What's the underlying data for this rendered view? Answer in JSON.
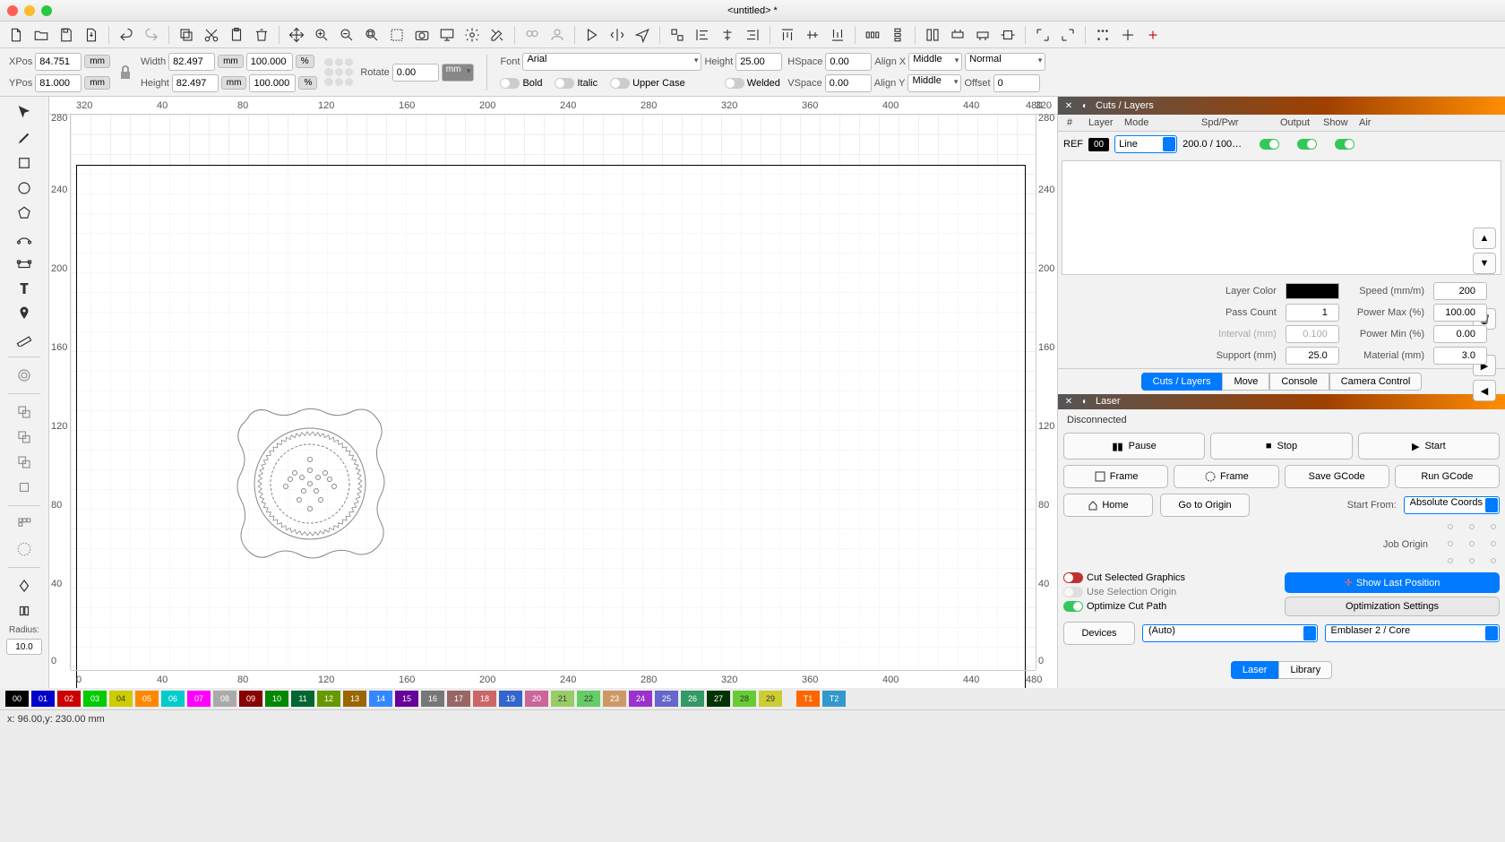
{
  "title": "<untitled> *",
  "props": {
    "xpos_lbl": "XPos",
    "xpos": "84.751",
    "ypos_lbl": "YPos",
    "ypos": "81.000",
    "width_lbl": "Width",
    "width": "82.497",
    "height_lbl": "Height",
    "height": "82.497",
    "w100": "100.000",
    "h100": "100.000",
    "mm": "mm",
    "pct": "%",
    "rotate_lbl": "Rotate",
    "rotate": "0.00",
    "font_lbl": "Font",
    "font": "Arial",
    "fheight_lbl": "Height",
    "fheight": "25.00",
    "hspace_lbl": "HSpace",
    "hspace": "0.00",
    "vspace_lbl": "VSpace",
    "vspace": "0.00",
    "alignx_lbl": "Align X",
    "alignx": "Middle",
    "aligny_lbl": "Align Y",
    "aligny": "Middle",
    "normal": "Normal",
    "offset_lbl": "Offset",
    "offset": "0",
    "bold": "Bold",
    "italic": "Italic",
    "upper": "Upper Case",
    "welded": "Welded"
  },
  "lefttool": {
    "radius_lbl": "Radius:",
    "radius": "10.0"
  },
  "ruler": {
    "t0": "320",
    "t1": "40",
    "t2": "80",
    "t3": "120",
    "t4": "160",
    "t5": "200",
    "t6": "240",
    "t7": "280",
    "t8": "320",
    "t9": "360",
    "t10": "400",
    "t11": "440",
    "t12": "480",
    "t13": "320",
    "b0": "0",
    "v0": "0",
    "v1": "40",
    "v2": "80",
    "v3": "120",
    "v4": "160",
    "v5": "200",
    "v6": "240",
    "v7": "280"
  },
  "cuts": {
    "title": "Cuts / Layers",
    "hdr_hash": "#",
    "hdr_layer": "Layer",
    "hdr_mode": "Mode",
    "hdr_spd": "Spd/Pwr",
    "hdr_out": "Output",
    "hdr_show": "Show",
    "hdr_air": "Air",
    "ref": "REF",
    "layer00": "00",
    "mode": "Line",
    "spdpwr": "200.0 / 100…",
    "lc_lbl": "Layer Color",
    "speed_lbl": "Speed (mm/m)",
    "speed": "200",
    "pass_lbl": "Pass Count",
    "pass": "1",
    "pmax_lbl": "Power Max (%)",
    "pmax": "100.00",
    "int_lbl": "Interval (mm)",
    "int": "0.100",
    "pmin_lbl": "Power Min (%)",
    "pmin": "0.00",
    "sup_lbl": "Support (mm)",
    "sup": "25.0",
    "mat_lbl": "Material (mm)",
    "mat": "3.0",
    "tab_cuts": "Cuts / Layers",
    "tab_move": "Move",
    "tab_console": "Console",
    "tab_cam": "Camera Control"
  },
  "laser": {
    "title": "Laser",
    "status": "Disconnected",
    "pause": "Pause",
    "stop": "Stop",
    "start": "Start",
    "frame1": "Frame",
    "frame2": "Frame",
    "save": "Save GCode",
    "run": "Run GCode",
    "home": "Home",
    "goto": "Go to Origin",
    "startfrom_lbl": "Start From:",
    "startfrom": "Absolute Coords",
    "joborigin": "Job Origin",
    "cutsel": "Cut Selected Graphics",
    "usesel": "Use Selection Origin",
    "opt": "Optimize Cut Path",
    "showlast": "Show Last Position",
    "optset": "Optimization Settings",
    "devices": "Devices",
    "auto": "(Auto)",
    "device": "Emblaser 2 / Core",
    "tab_laser": "Laser",
    "tab_lib": "Library"
  },
  "palette": {
    "c00": "00",
    "c01": "01",
    "c02": "02",
    "c03": "03",
    "c04": "04",
    "c05": "05",
    "c06": "06",
    "c07": "07",
    "c08": "08",
    "c09": "09",
    "c10": "10",
    "c11": "11",
    "c12": "12",
    "c13": "13",
    "c14": "14",
    "c15": "15",
    "c16": "16",
    "c17": "17",
    "c18": "18",
    "c19": "19",
    "c20": "20",
    "c21": "21",
    "c22": "22",
    "c23": "23",
    "c24": "24",
    "c25": "25",
    "c26": "26",
    "c27": "27",
    "c28": "28",
    "c29": "29",
    "t1": "T1",
    "t2": "T2"
  },
  "statusbar": "x: 96.00,y: 230.00 mm"
}
